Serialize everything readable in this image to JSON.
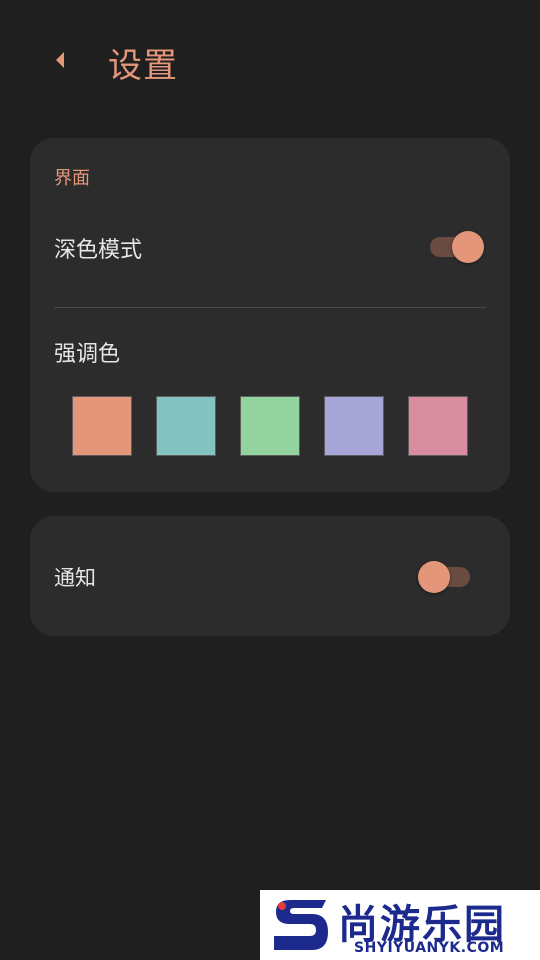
{
  "header": {
    "title": "设置",
    "back_icon": "chevron-left-icon"
  },
  "appearance": {
    "section_label": "界面",
    "dark_mode": {
      "label": "深色模式",
      "enabled": true
    },
    "accent": {
      "label": "强调色",
      "colors": [
        "#e4967a",
        "#82c3bf",
        "#93d49e",
        "#a8a6d6",
        "#d78c9f"
      ]
    }
  },
  "notifications": {
    "label": "通知",
    "enabled": false
  },
  "theme": {
    "accent": "#e4967a",
    "background": "#1f1f1f",
    "card": "#2c2c2c"
  },
  "watermark": {
    "cn": "尚游乐园",
    "en": "SHYIYUANYK.COM"
  }
}
